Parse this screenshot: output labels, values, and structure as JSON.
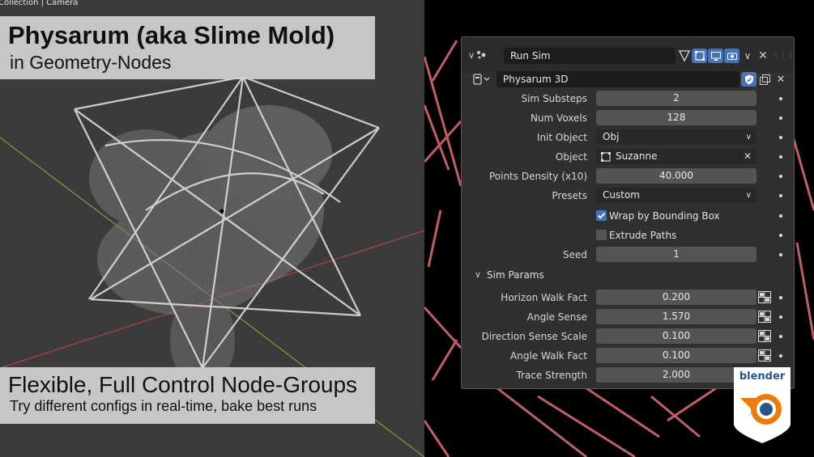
{
  "viewport": {
    "crumb": "Collection | Camera"
  },
  "overlay": {
    "title": "Physarum (aka Slime Mold)",
    "subtitle": "in Geometry-Nodes",
    "bottom_title": "Flexible, Full Control Node-Groups",
    "bottom_subtitle": "Try different configs in real-time, bake best runs"
  },
  "panel": {
    "modifier_name": "Run Sim",
    "node_group": "Physarum 3D",
    "fields": [
      {
        "label": "Sim Substeps",
        "value": "2"
      },
      {
        "label": "Num Voxels",
        "value": "128"
      },
      {
        "label": "Init Object",
        "value": "Obj"
      },
      {
        "label": "Object",
        "value": "Suzanne"
      },
      {
        "label": "Points Density (x10)",
        "value": "40.000"
      },
      {
        "label": "Presets",
        "value": "Custom"
      }
    ],
    "checks": [
      {
        "label": "Wrap by Bounding Box",
        "checked": true
      },
      {
        "label": "Extrude Paths",
        "checked": false
      }
    ],
    "seed": {
      "label": "Seed",
      "value": "1"
    },
    "section": "Sim Params",
    "params": [
      {
        "label": "Horizon Walk Fact",
        "value": "0.200"
      },
      {
        "label": "Angle Sense",
        "value": "1.570"
      },
      {
        "label": "Direction Sense Scale",
        "value": "0.100"
      },
      {
        "label": "Angle Walk Fact",
        "value": "0.100"
      },
      {
        "label": "Trace Strength",
        "value": "2.000"
      }
    ]
  },
  "logo": {
    "text": "blender"
  },
  "colors": {
    "accent": "#4772b3",
    "panel_bg": "#303030",
    "field_bg": "#545454",
    "logo_orange": "#e87d0d",
    "logo_blue": "#265787"
  }
}
